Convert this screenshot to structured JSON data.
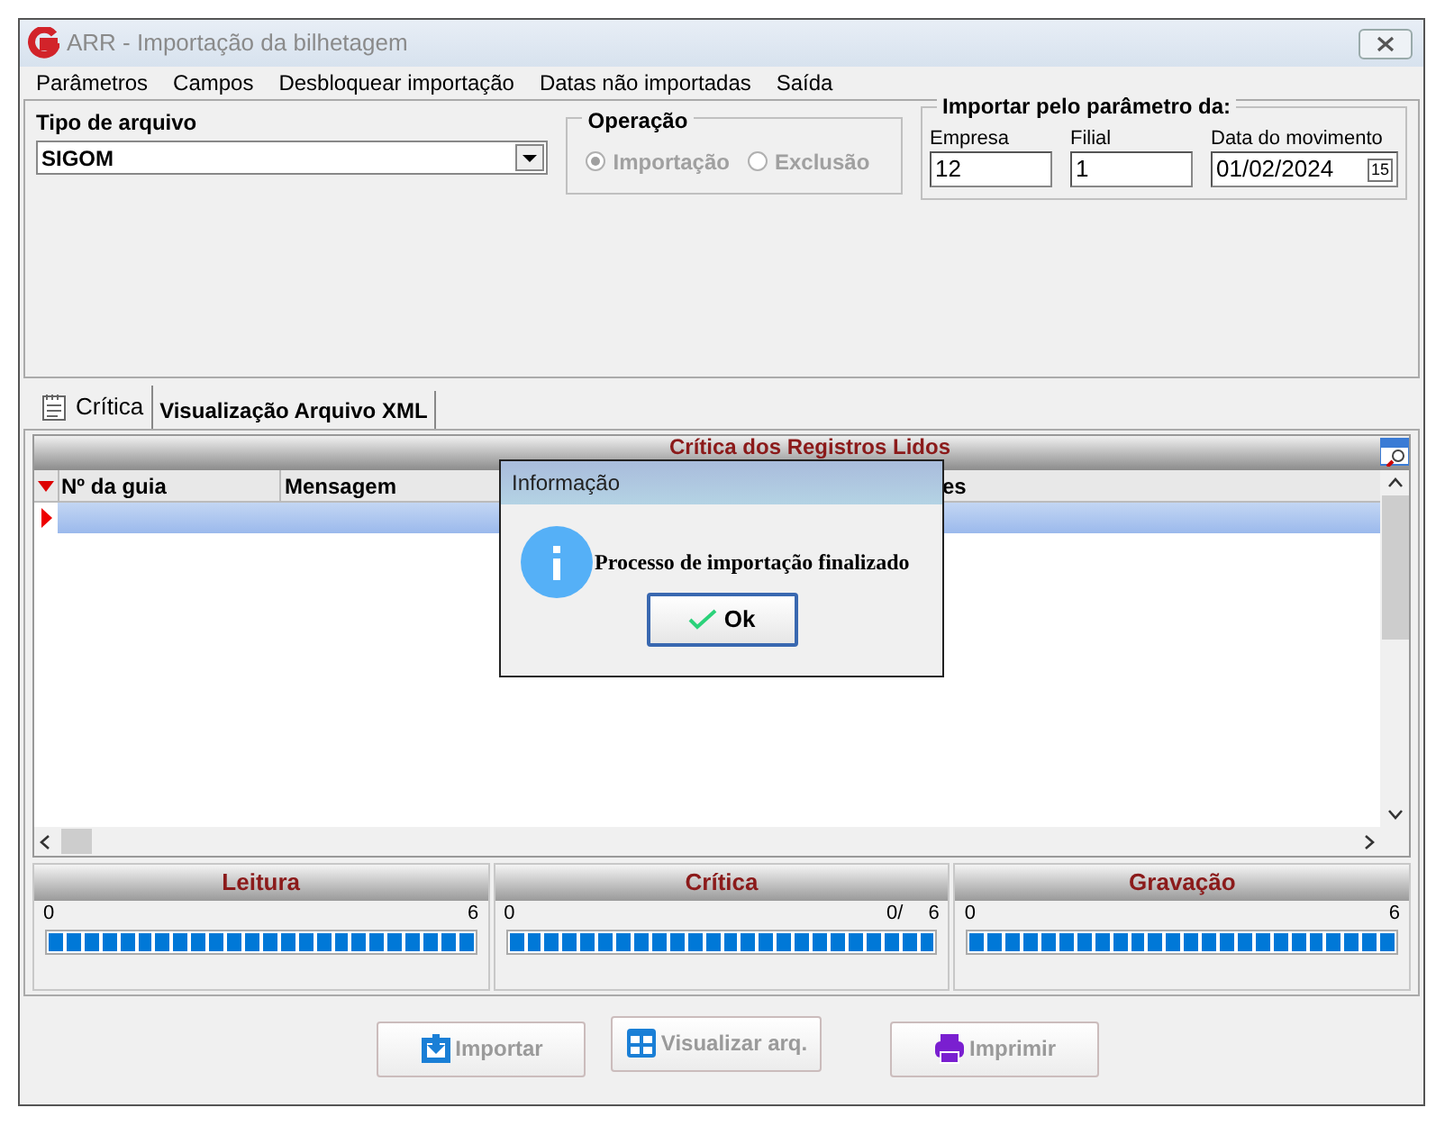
{
  "window": {
    "title": "ARR - Importação da bilhetagem"
  },
  "menu": [
    "Parâmetros",
    "Campos",
    "Desbloquear importação",
    "Datas não importadas",
    "Saída"
  ],
  "file_type": {
    "label": "Tipo de arquivo",
    "value": "SIGOM"
  },
  "operation": {
    "label": "Operação",
    "options": [
      {
        "label": "Importação",
        "selected": true
      },
      {
        "label": "Exclusão",
        "selected": false
      }
    ],
    "disabled": true
  },
  "import_params": {
    "label": "Importar pelo parâmetro da:",
    "fields": [
      {
        "label": "Empresa",
        "value": "12"
      },
      {
        "label": "Filial",
        "value": "1"
      },
      {
        "label": "Data do movimento",
        "value": "01/02/2024",
        "kind": "date",
        "calendar": "15"
      }
    ]
  },
  "tabs": [
    {
      "label": "Crítica",
      "selected": true
    },
    {
      "label": "Visualização Arquivo XML",
      "selected": false
    }
  ],
  "grid": {
    "title": "Crítica dos Registros Lidos",
    "columns": [
      "Nº da guia",
      "Mensagem",
      "es"
    ]
  },
  "progress": [
    {
      "title": "Leitura",
      "min": "0",
      "max": "6",
      "level": 1
    },
    {
      "title": "Crítica",
      "min": "0",
      "mid": "0/",
      "max": "6",
      "level": 1
    },
    {
      "title": "Gravação",
      "min": "0",
      "max": "6",
      "level": 1
    }
  ],
  "buttons": [
    {
      "label": "Importar",
      "kind": "import"
    },
    {
      "label": "Visualizar arq.",
      "kind": "view"
    },
    {
      "label": "Imprimir",
      "kind": "print"
    }
  ],
  "dialog": {
    "title": "Informação",
    "message": "Processo de importação finalizado",
    "button": "Ok"
  }
}
